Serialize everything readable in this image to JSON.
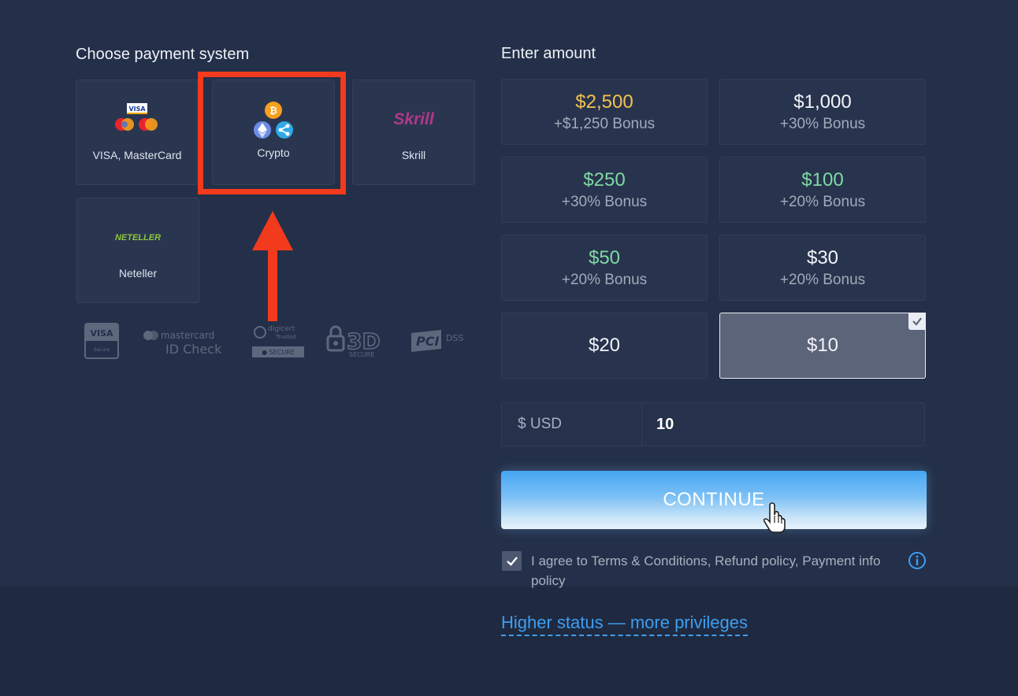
{
  "payment": {
    "title": "Choose payment system",
    "methods": [
      {
        "label": "VISA, MasterCard",
        "icon": "visa-mastercard-icon"
      },
      {
        "label": "Crypto",
        "icon": "crypto-icon",
        "highlighted": true
      },
      {
        "label": "Skrill",
        "icon": "skrill-logo"
      },
      {
        "label": "Neteller",
        "icon": "neteller-logo"
      }
    ],
    "trust_badges": [
      {
        "name": "visa-secure-badge",
        "text": "VISA"
      },
      {
        "name": "mastercard-id-check-badge",
        "text": "mastercard ID Check"
      },
      {
        "name": "digicert-secure-badge",
        "text": "digicert SECURE"
      },
      {
        "name": "3d-secure-badge",
        "text": "3D SECURE"
      },
      {
        "name": "pci-dss-badge",
        "text": "PCI DSS"
      }
    ]
  },
  "amount": {
    "title": "Enter amount",
    "options": [
      {
        "value": "$2,500",
        "bonus": "+$1,250 Bonus",
        "color": "#f4c14e"
      },
      {
        "value": "$1,000",
        "bonus": "+30% Bonus",
        "color": "#f1f4f9"
      },
      {
        "value": "$250",
        "bonus": "+30% Bonus",
        "color": "#7ed9a3"
      },
      {
        "value": "$100",
        "bonus": "+20% Bonus",
        "color": "#7ed9a3"
      },
      {
        "value": "$50",
        "bonus": "+20% Bonus",
        "color": "#7ed9a3"
      },
      {
        "value": "$30",
        "bonus": "+20% Bonus",
        "color": "#f1f4f9"
      },
      {
        "value": "$20",
        "bonus": "",
        "color": "#f1f4f9"
      },
      {
        "value": "$10",
        "bonus": "",
        "color": "#f1f4f9",
        "selected": true
      }
    ],
    "currency_label": "$ USD",
    "input_value": "10"
  },
  "continue_label": "CONTINUE",
  "agreement": {
    "checked": true,
    "text": "I agree to Terms & Conditions, Refund policy, Payment info policy"
  },
  "privileges_link": "Higher status — more privileges",
  "colors": {
    "background": "#243049",
    "highlight": "#f23a1c",
    "accent": "#3d9ef2",
    "gold": "#f4c14e",
    "green": "#7ed9a3"
  }
}
